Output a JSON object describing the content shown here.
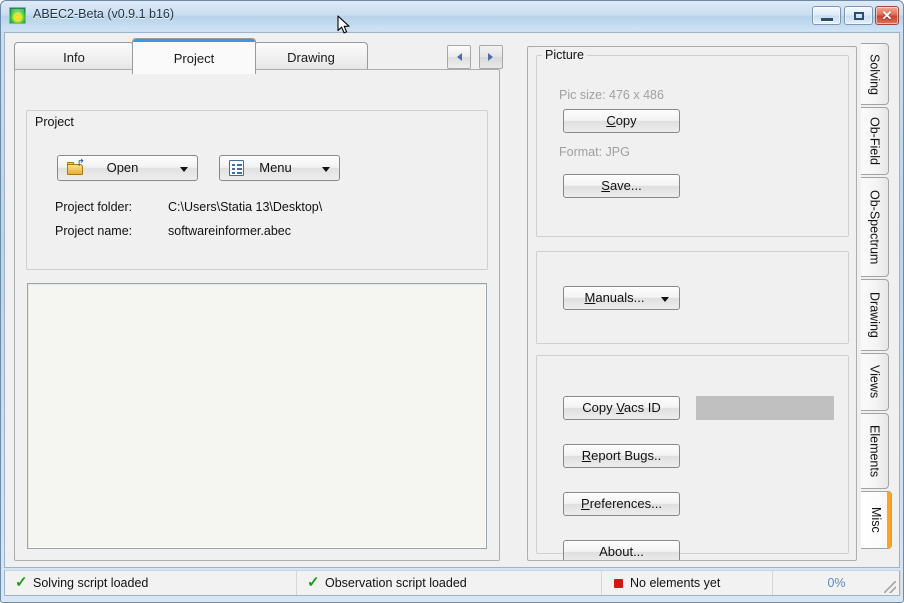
{
  "window": {
    "title": "ABEC2-Beta (v0.9.1 b16)",
    "icon": "app-gradient-icon",
    "controls": {
      "minimize": "minimize-icon",
      "maximize": "maximize-icon",
      "close": "✕"
    }
  },
  "tabs": {
    "items": [
      {
        "label": "Info",
        "active": false
      },
      {
        "label": "Project",
        "active": true
      },
      {
        "label": "Drawing",
        "active": false
      }
    ],
    "nav": {
      "prev": "prev-arrow-icon",
      "next": "next-arrow-icon"
    }
  },
  "project_group": {
    "title": "Project",
    "open_button": {
      "label": "Open",
      "icon": "open-folder-icon",
      "caret": "chevron-down-icon"
    },
    "menu_button": {
      "label": "Menu",
      "icon": "list-icon",
      "caret": "chevron-down-icon"
    },
    "folder_label": "Project folder:",
    "folder_value": "C:\\Users\\Statia 13\\Desktop\\",
    "name_label": "Project name:",
    "name_value": "softwareinformer.abec"
  },
  "picture_group": {
    "title": "Picture",
    "pic_size": "Pic size: 476 x 486",
    "copy_button": "Copy",
    "copy_accel": "C",
    "format": "Format: JPG",
    "save_button": "Save...",
    "save_accel": "S"
  },
  "manuals_group": {
    "manuals_button": "Manuals...",
    "manuals_accel": "M",
    "caret": "chevron-down-icon"
  },
  "misc_group": {
    "vacs_button": "Copy Vacs ID",
    "vacs_accel": "V",
    "vacs_field_value": "",
    "bugs_button": "Report Bugs..",
    "bugs_accel": "R",
    "prefs_button": "Preferences...",
    "prefs_accel": "P",
    "about_button": "About..."
  },
  "side_tabs": {
    "items": [
      {
        "label": "Solving",
        "active": false
      },
      {
        "label": "Ob-Field",
        "active": false
      },
      {
        "label": "Ob-Spectrum",
        "active": false
      },
      {
        "label": "Drawing",
        "active": false
      },
      {
        "label": "Views",
        "active": false
      },
      {
        "label": "Elements",
        "active": false
      },
      {
        "label": "Misc",
        "active": true
      }
    ],
    "active_accent": "#f5a623"
  },
  "statusbar": {
    "cells": [
      {
        "text": "Solving script loaded",
        "indicator": "check",
        "color": "#18a018"
      },
      {
        "text": "Observation script loaded",
        "indicator": "check",
        "color": "#18a018"
      },
      {
        "text": "No elements yet",
        "indicator": "square",
        "color": "#d81515"
      },
      {
        "text": "0%",
        "indicator": "none",
        "color": "#5a8ac0"
      }
    ],
    "grip": "resize-grip-icon"
  },
  "colors": {
    "titlebar_start": "#dfeaf6",
    "titlebar_end": "#cfe3f5",
    "client_bg": "#f0f0f0",
    "active_tab_accent": "#3c97e8",
    "side_accent": "#f5a623",
    "ok": "#18a018",
    "error": "#d81515",
    "progress_text": "#5a8ac0"
  }
}
